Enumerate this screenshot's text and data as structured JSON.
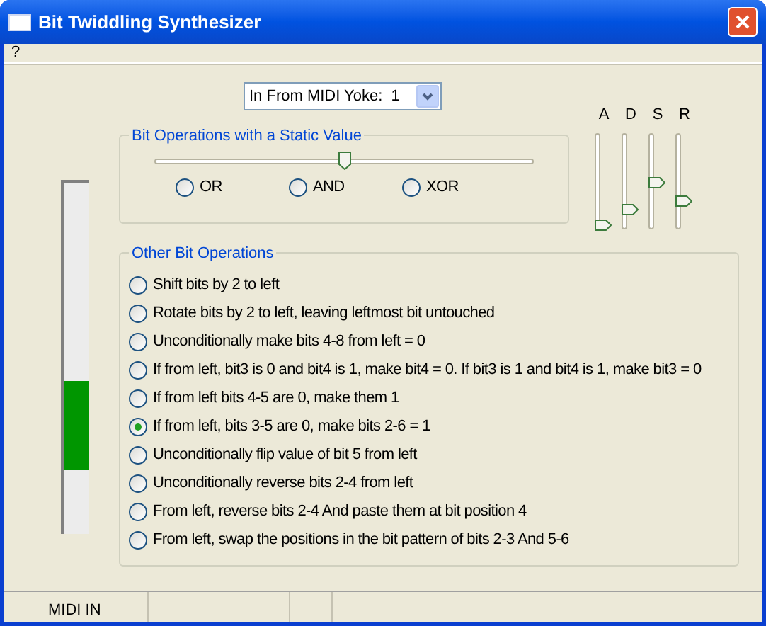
{
  "window": {
    "title": "Bit Twiddling Synthesizer"
  },
  "menu": [
    "?"
  ],
  "midi_input": {
    "value": "In From MIDI Yoke:  1"
  },
  "meter": {
    "level": 0.31
  },
  "static_group": {
    "title": "Bit Operations with a Static Value",
    "slider": {
      "level": 0.5
    },
    "options": [
      {
        "label": "OR",
        "selected": false
      },
      {
        "label": "AND",
        "selected": false
      },
      {
        "label": "XOR",
        "selected": false
      }
    ]
  },
  "envelope": [
    {
      "label": "A",
      "level": 0.05
    },
    {
      "label": "D",
      "level": 0.21
    },
    {
      "label": "S",
      "level": 0.48
    },
    {
      "label": "R",
      "level": 0.3
    }
  ],
  "other_group": {
    "title": "Other Bit Operations",
    "options": [
      {
        "label": "Shift bits by 2 to left",
        "selected": false
      },
      {
        "label": "Rotate bits by 2 to left, leaving leftmost bit untouched",
        "selected": false
      },
      {
        "label": "Unconditionally make bits 4-8 from left = 0",
        "selected": false
      },
      {
        "label": "If from left, bit3 is 0 and bit4 is 1, make bit4 = 0. If bit3 is 1 and bit4 is 1, make bit3 = 0",
        "selected": false
      },
      {
        "label": "If from left bits 4-5 are 0, make them 1",
        "selected": false
      },
      {
        "label": "If from left, bits 3-5 are 0, make bits 2-6 = 1",
        "selected": true
      },
      {
        "label": "Unconditionally flip value of bit 5 from left",
        "selected": false
      },
      {
        "label": "Unconditionally reverse bits 2-4 from left",
        "selected": false
      },
      {
        "label": "From left, reverse bits 2-4 And paste them at bit position 4",
        "selected": false
      },
      {
        "label": "From left, swap the positions in the bit pattern of bits 2-3 And 5-6",
        "selected": false
      }
    ]
  },
  "status_bar": [
    {
      "text": "MIDI IN"
    }
  ]
}
